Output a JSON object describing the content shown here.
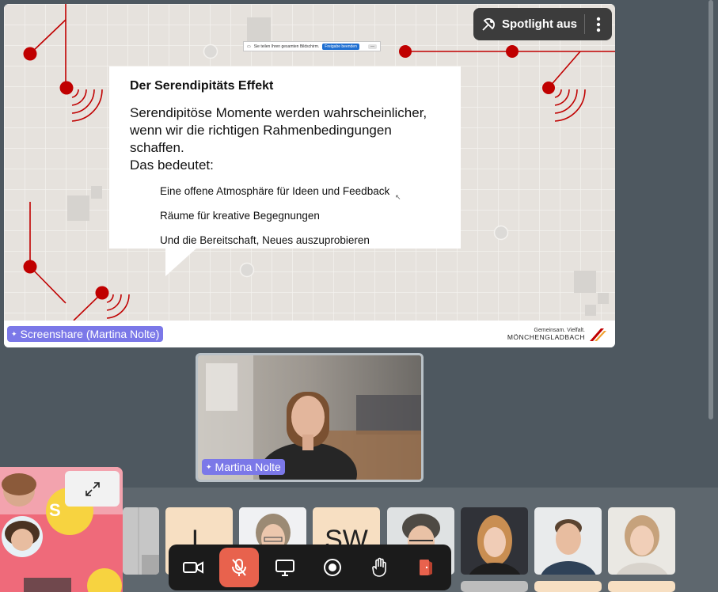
{
  "share_indicator": {
    "text": "Sie teilen Ihren gesamten Bildschirm.",
    "end_label": "Freigabe beenden",
    "min_label": "—"
  },
  "slide": {
    "title": "Der Serendipitäts Effekt",
    "intro_line1": "Serendipitöse Momente werden wahrscheinlicher,",
    "intro_line2": "wenn wir die richtigen Rahmenbedingungen schaffen.",
    "intro_line3": "Das bedeutet:",
    "bullets": [
      "Eine offene Atmosphäre für Ideen und Feedback",
      "Räume für kreative Begegnungen",
      "Und die Bereitschaft, Neues auszuprobieren"
    ],
    "footer_tagline": "Gemeinsam. Vielfalt.",
    "footer_city": "MÖNCHENGLADBACH"
  },
  "spotlight": {
    "label": "Spotlight aus"
  },
  "screenshare_tag": {
    "label": "Screenshare (Martina Nolte)"
  },
  "speaker_tag": {
    "label": "Martina Nolte"
  },
  "gallery": {
    "tile_initials_1": "L",
    "tile_initials_2": "SW",
    "self_badge": "S"
  },
  "colors": {
    "accent_red": "#c00000",
    "tag_purple": "#7b78e8",
    "mic_muted": "#e8624d",
    "leave": "#e8624d"
  },
  "icons": [
    "spotlight-off-icon",
    "more-vertical-icon",
    "sparkle-icon",
    "expand-icon",
    "camera-icon",
    "mic-off-icon",
    "screen-share-icon",
    "record-icon",
    "raise-hand-icon",
    "leave-icon"
  ]
}
